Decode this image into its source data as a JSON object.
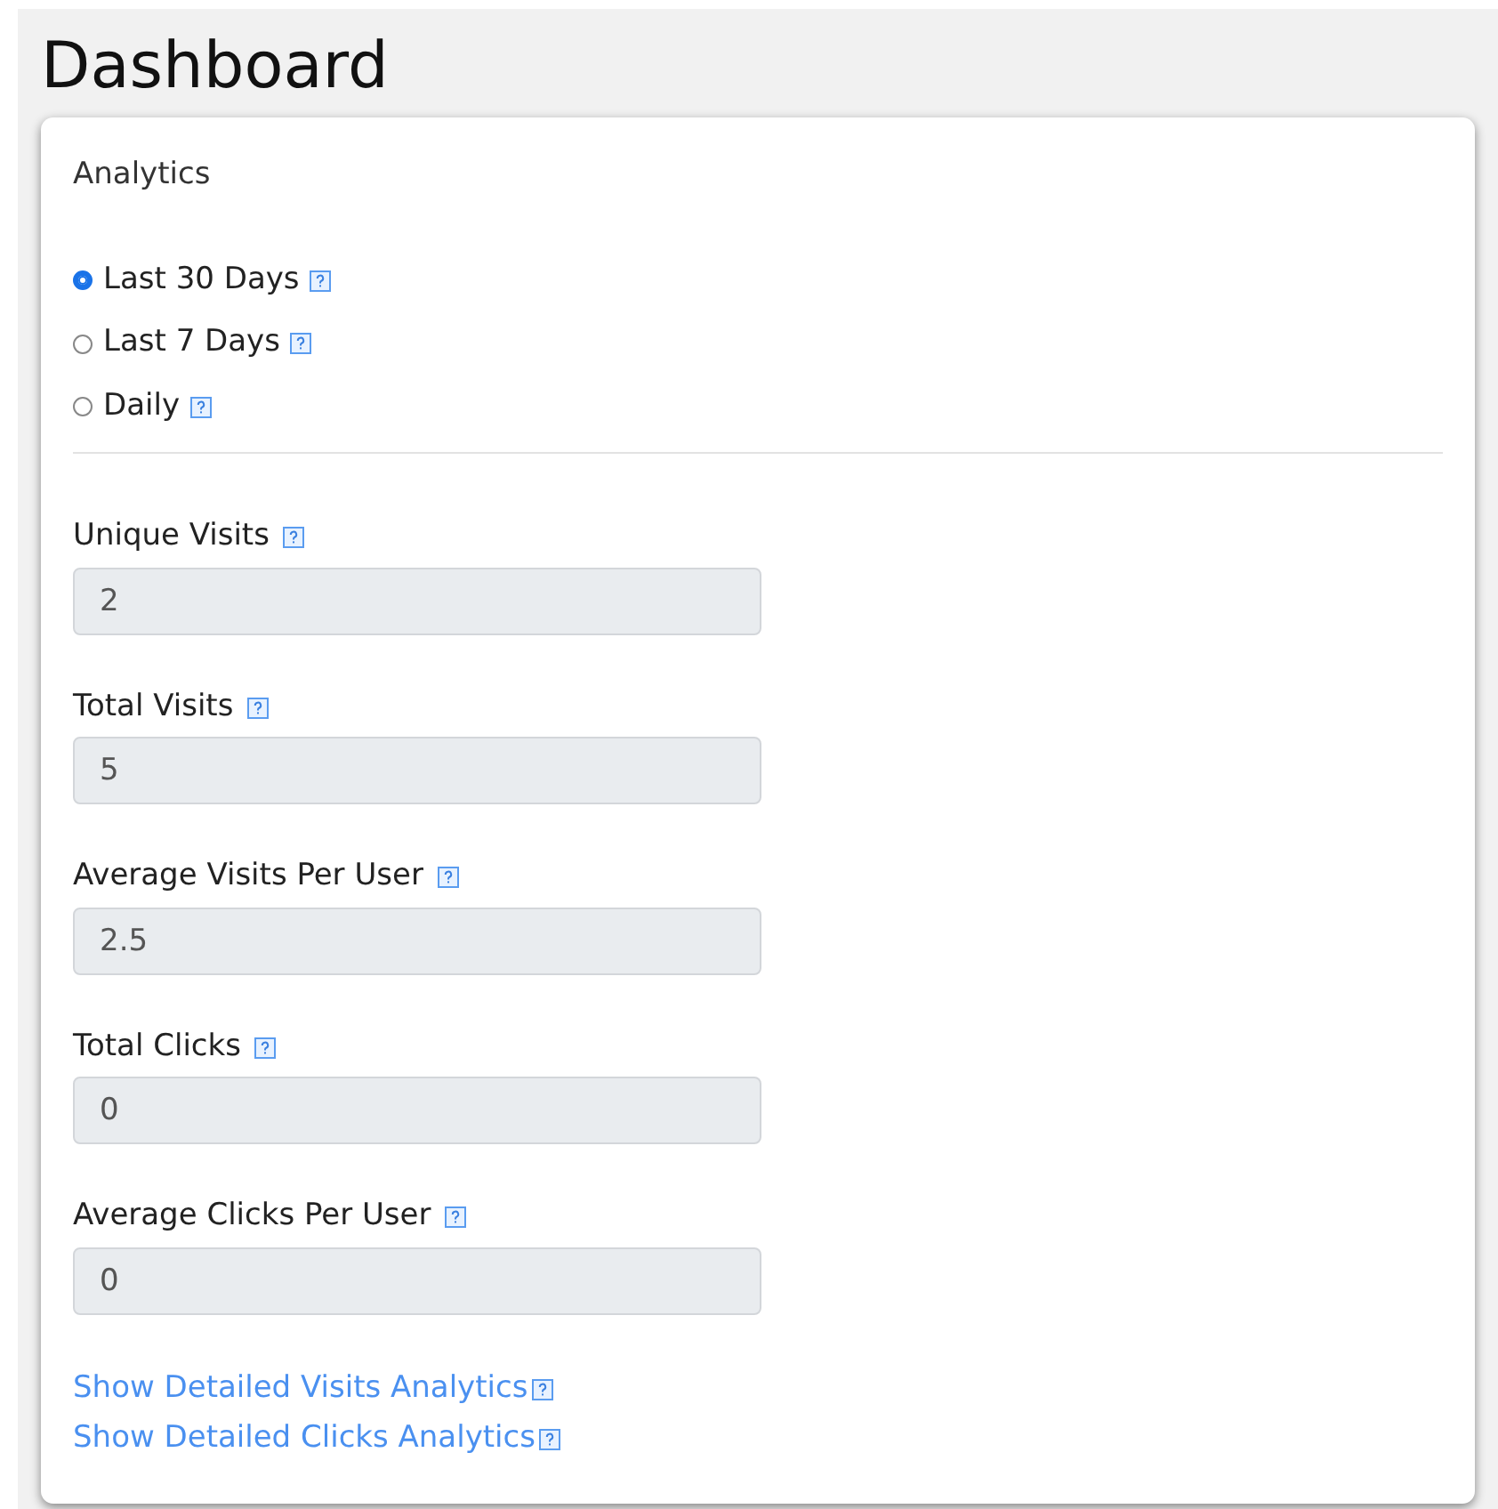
{
  "page_title": "Dashboard",
  "card": {
    "title": "Analytics",
    "periods": [
      {
        "label": "Last 30 Days",
        "selected": true
      },
      {
        "label": "Last 7 Days",
        "selected": false
      },
      {
        "label": "Daily",
        "selected": false
      }
    ],
    "fields": [
      {
        "label": "Unique Visits",
        "value": "2"
      },
      {
        "label": "Total Visits",
        "value": "5"
      },
      {
        "label": "Average Visits Per User",
        "value": "2.5"
      },
      {
        "label": "Total Clicks",
        "value": "0"
      },
      {
        "label": "Average Clicks Per User",
        "value": "0"
      }
    ],
    "links": [
      "Show Detailed Visits Analytics",
      "Show Detailed Clicks Analytics"
    ]
  }
}
